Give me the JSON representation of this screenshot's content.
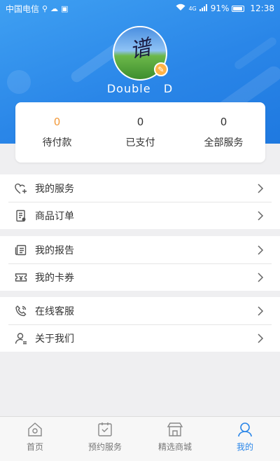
{
  "status_bar": {
    "carrier": "中国电信",
    "signal_extra": "4G",
    "battery": "91%",
    "time": "12:38"
  },
  "profile": {
    "username": "Double   D"
  },
  "stats": [
    {
      "value": "0",
      "label": "待付款"
    },
    {
      "value": "0",
      "label": "已支付"
    },
    {
      "value": "0",
      "label": "全部服务"
    }
  ],
  "menu": {
    "group1": [
      {
        "label": "我的服务",
        "icon": "heart-plus-icon"
      },
      {
        "label": "商品订单",
        "icon": "order-icon"
      }
    ],
    "group2": [
      {
        "label": "我的报告",
        "icon": "report-icon"
      },
      {
        "label": "我的卡券",
        "icon": "coupon-icon"
      }
    ],
    "group3": [
      {
        "label": "在线客服",
        "icon": "phone-icon"
      },
      {
        "label": "关于我们",
        "icon": "user-icon"
      }
    ]
  },
  "tabbar": [
    {
      "label": "首页",
      "icon": "home-icon"
    },
    {
      "label": "预约服务",
      "icon": "appointment-icon"
    },
    {
      "label": "精选商城",
      "icon": "shop-icon"
    },
    {
      "label": "我的",
      "icon": "profile-icon",
      "active": true
    }
  ],
  "colors": {
    "accent": "#2a86e8",
    "highlight": "#f2993a",
    "background": "#efeff1"
  }
}
